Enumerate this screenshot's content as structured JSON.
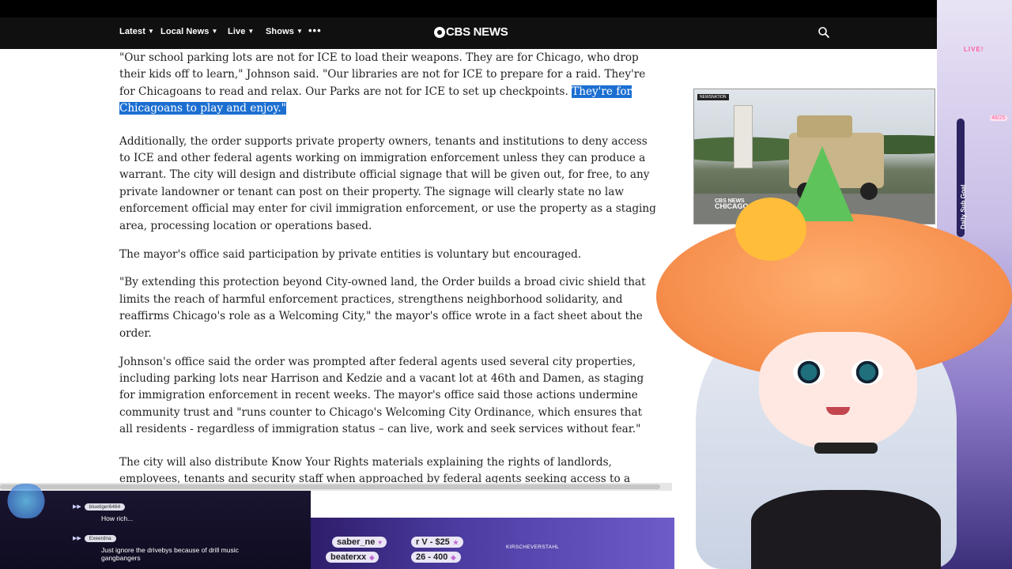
{
  "nav": {
    "items": [
      {
        "label": "Latest"
      },
      {
        "label": "Local News"
      },
      {
        "label": "Live"
      },
      {
        "label": "Shows"
      }
    ],
    "more_label": "•••",
    "logo_text": "CBS NEWS"
  },
  "article": {
    "quote_lead": "\"Our school parking lots are not for ICE to load their weapons. They are for Chicago, who drop their kids off to learn,\" Johnson said. \"Our libraries are not for ICE to prepare for a raid. They're for Chicagoans to read and relax. Our Parks are not for ICE to set up checkpoints. ",
    "quote_highlight": "They're for Chicagoans to play and enjoy.\"",
    "p2": "Additionally, the order supports private property owners, tenants and institutions to deny access to ICE and other federal agents working on immigration enforcement unless they can produce a warrant. The city will design and distribute official signage that will be given out, for free, to any private landowner or tenant can post on their property. The signage will clearly state no law enforcement official may enter for civil immigration enforcement, or use the property as a staging area, processing location or operations based.",
    "p3": "The mayor's office said participation by private entities is voluntary but encouraged.",
    "p4": "\"By extending this protection beyond City-owned land, the Order builds a broad civic shield that limits the reach of harmful enforcement practices, strengthens neighborhood solidarity, and reaffirms Chicago's role as a Welcoming City,\" the mayor's office wrote in a fact sheet about the order.",
    "p5": "Johnson's office said the order was prompted after federal agents used several city properties, including parking lots near Harrison and Kedzie and a vacant lot at 46th and Damen, as staging for immigration enforcement in recent weeks. The mayor's office said those actions undermine community trust and \"runs counter to Chicago's Welcoming City Ordinance, which ensures that all residents - regardless of immigration status – can live, work and seek services without fear.\"",
    "p6": "The city will also distribute Know Your Rights materials explaining the rights of landlords, employees, tenants and security staff when approached by federal agents seeking access to a property."
  },
  "video": {
    "tag": "NEWSNATION",
    "badge_line1": "CBS NEWS",
    "badge_line2": "CHICAGO"
  },
  "stream": {
    "live_label": "LIVE!",
    "sub_goal_label": "Daily Sub Goal",
    "sub_goal_count": "48/25",
    "handle": "KIRSCHEVERSTAHL",
    "goals": [
      {
        "text": "saber_ne"
      },
      {
        "text": "r V - $25"
      },
      {
        "text": "beaterxx"
      },
      {
        "text": "26 - 400"
      }
    ]
  },
  "chat": [
    {
      "user": "bluetiger6464",
      "text": "How rich..."
    },
    {
      "user": "Exeerdna",
      "text": "Just ignore the drivebys because of drill music gangbangers"
    }
  ],
  "colors": {
    "highlight": "#1c6fd1",
    "nav_bg": "#101010"
  }
}
